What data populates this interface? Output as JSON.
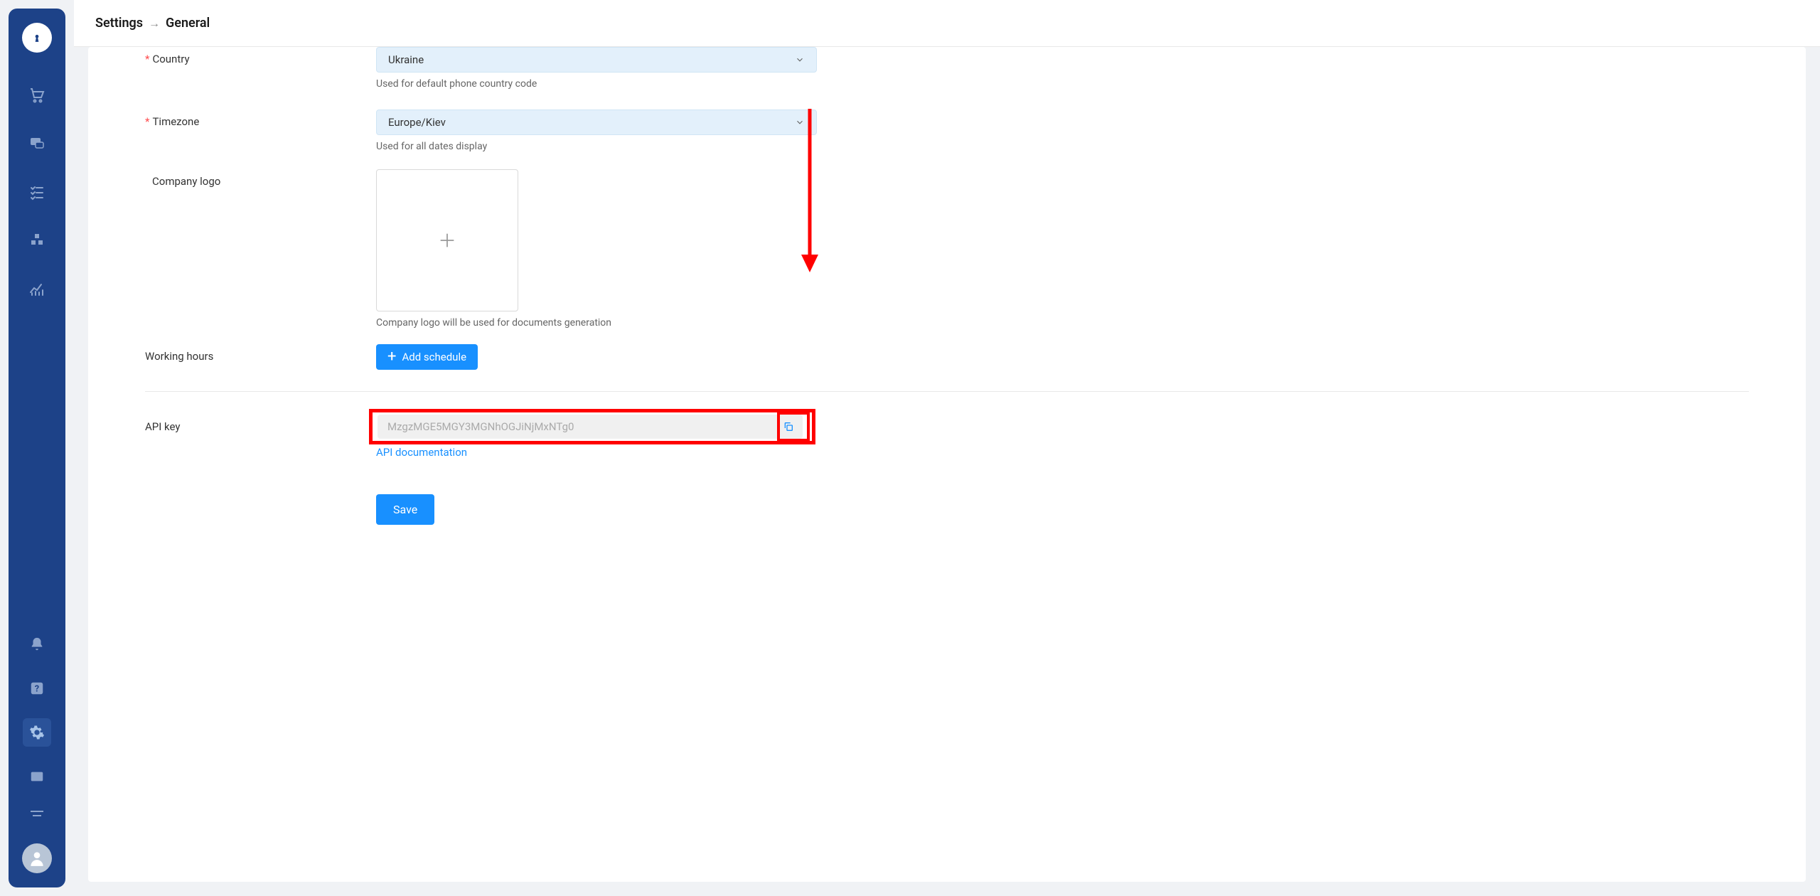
{
  "header": {
    "title": "Settings",
    "subtitle": "General"
  },
  "form": {
    "country": {
      "label": "Country",
      "value": "Ukraine",
      "help": "Used for default phone country code"
    },
    "timezone": {
      "label": "Timezone",
      "value": "Europe/Kiev",
      "help": "Used for all dates display"
    },
    "logo": {
      "label": "Company logo",
      "help": "Company logo will be used for documents generation"
    },
    "working_hours": {
      "label": "Working hours",
      "add_button": "Add schedule"
    },
    "api_key": {
      "label": "API key",
      "value": "MzgzMGE5MGY3MGNhOGJiNjMxNTg0",
      "doc_link": "API documentation"
    },
    "save_button": "Save"
  }
}
